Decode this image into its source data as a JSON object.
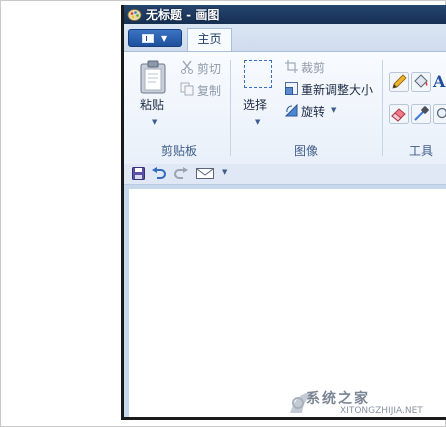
{
  "window": {
    "title": "无标题 - 画图"
  },
  "tabs": {
    "home": "主页"
  },
  "ribbon": {
    "clipboard": {
      "paste": "粘贴",
      "cut": "剪切",
      "copy": "复制",
      "group_label": "剪贴板"
    },
    "image": {
      "select": "选择",
      "crop": "裁剪",
      "resize": "重新调整大小",
      "rotate": "旋转",
      "group_label": "图像"
    },
    "tools": {
      "text_glyph": "A",
      "group_label": "工具"
    }
  },
  "watermark": {
    "brand": "系统之家",
    "url": "XITONGZHIJIA.NET"
  },
  "colors": {
    "titlebar": "#1f3d66",
    "accent": "#1d4f9c",
    "ribbon_bg": "#f8fbff"
  }
}
